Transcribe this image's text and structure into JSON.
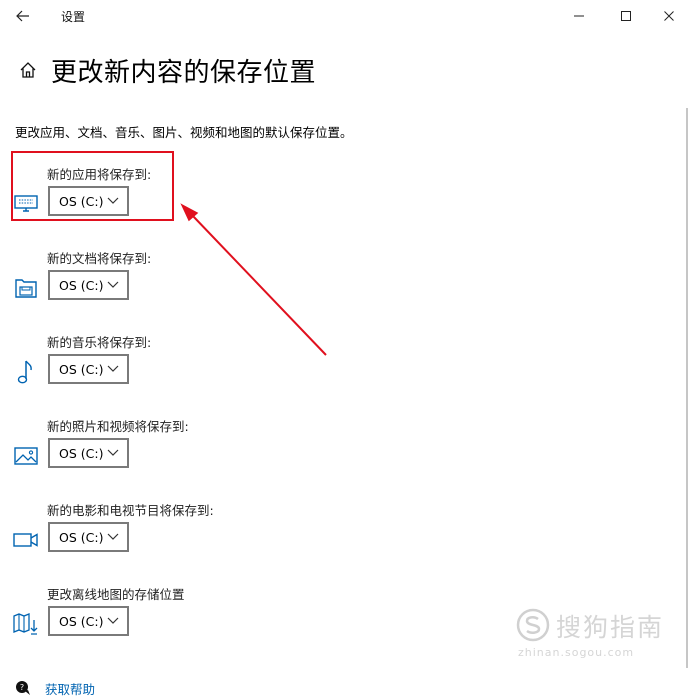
{
  "window": {
    "app_title": "设置",
    "back_icon": "back-arrow-icon",
    "controls": [
      "minimize-icon",
      "maximize-icon",
      "close-icon"
    ]
  },
  "header": {
    "home_icon": "home-icon",
    "title": "更改新内容的保存位置"
  },
  "description": "更改应用、文档、音乐、图片、视频和地图的默认保存位置。",
  "settings": [
    {
      "label": "新的应用将保存到:",
      "icon": "monitor-keyboard-icon",
      "value": "OS (C:)"
    },
    {
      "label": "新的文档将保存到:",
      "icon": "documents-folder-icon",
      "value": "OS (C:)"
    },
    {
      "label": "新的音乐将保存到:",
      "icon": "music-note-icon",
      "value": "OS (C:)"
    },
    {
      "label": "新的照片和视频将保存到:",
      "icon": "picture-icon",
      "value": "OS (C:)"
    },
    {
      "label": "新的电影和电视节目将保存到:",
      "icon": "video-camera-icon",
      "value": "OS (C:)"
    },
    {
      "label": "更改离线地图的存储位置",
      "icon": "map-download-icon",
      "value": "OS (C:)"
    }
  ],
  "help": {
    "label": "获取帮助",
    "icon": "help-chat-icon"
  },
  "annotation": {
    "color": "#e0101e"
  },
  "watermark": {
    "text": "搜狗指南",
    "sub": "zhinan.sogou.com"
  },
  "colors": {
    "link": "#0063b1",
    "border": "#7a7a7a"
  }
}
